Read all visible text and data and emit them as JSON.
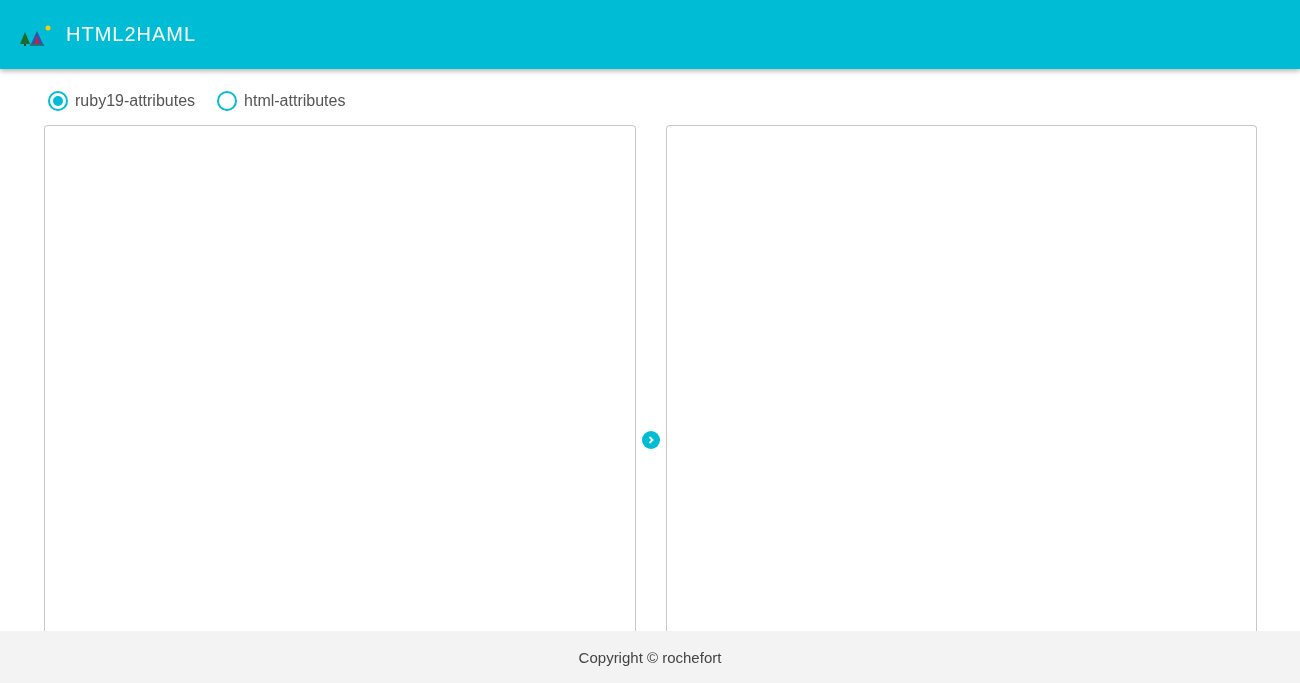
{
  "header": {
    "title": "HTML2HAML"
  },
  "options": [
    {
      "label": "ruby19-attributes",
      "selected": true
    },
    {
      "label": "html-attributes",
      "selected": false
    }
  ],
  "footer": {
    "text": "Copyright © rochefort"
  }
}
